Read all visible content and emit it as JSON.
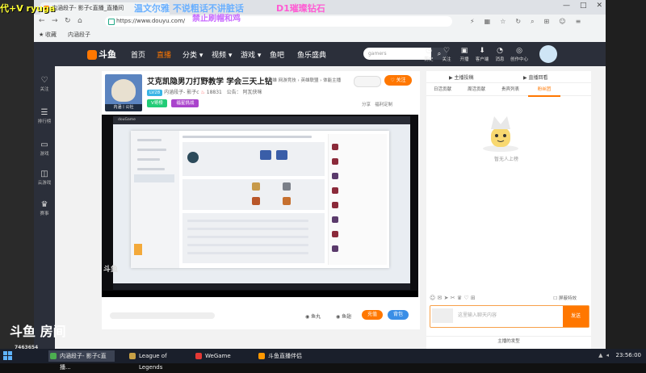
{
  "browser": {
    "tab_title": "内涵段子- 影子c直播_直播间",
    "url": "https://www.douyu.com/",
    "bookmarks": [
      "收藏",
      "内涵段子"
    ],
    "win_minimize": "—",
    "win_maximize": "□",
    "win_close": "✕"
  },
  "douyu": {
    "logo_text": "斗鱼",
    "nav": [
      "首页",
      "直播",
      "分类 ▾",
      "视频 ▾",
      "游戏 ▾",
      "鱼吧",
      "鱼乐盛典"
    ],
    "search_placeholder": "gamers",
    "header_icons": [
      "历史",
      "关注",
      "开播",
      "客户端",
      "消息",
      "创作中心"
    ],
    "side_items": [
      "关注",
      "排行榜",
      "游戏",
      "云游戏",
      "赛事"
    ]
  },
  "room": {
    "title": "艾克凯隐男刀打野教学 学会三天上钻",
    "categories": "英雄  网游竞技 › 英雄联盟 › 体能主播",
    "level_badge": "LV28",
    "anchor_name": "内涵段子- 影子c",
    "heat": "18831",
    "notice": "公告：  阿瓦侠咪",
    "avatar_tag": "内涵丨公社",
    "badge_level": "V哥榜",
    "badge_event": "福星挑战",
    "follow": "关注",
    "share": "分享",
    "report": "福利定制",
    "yuwan": "鱼丸",
    "yuchi": "鱼翅",
    "recharge": "充值",
    "backpack": "背包",
    "player_logo": "斗鱼"
  },
  "chat": {
    "top_left": "主播投稿",
    "top_right": "直播回看",
    "tabs": [
      "日活贡献",
      "周活贡献",
      "贵宾列表",
      "粉丝团"
    ],
    "empty_text": "暂无人上榜",
    "shield_label": "屏蔽特效",
    "input_placeholder": "这里输入聊天内容",
    "send": "发送",
    "fans_bar": "主播的发型"
  },
  "overlay": {
    "line1": "代+V ryuga",
    "line2": "温文尔雅 不说粗话不讲脏话",
    "line3": "D1璀璨钻石",
    "line4": "禁止刷帽和鸡",
    "room_id_label": "斗鱼 房间",
    "room_id": "7463654"
  },
  "taskbar": {
    "items": [
      "内涵段子- 影子c直播...",
      "League of Legends",
      "WeGame",
      "斗鱼直播伴侣"
    ],
    "clock": "23:56:00"
  }
}
